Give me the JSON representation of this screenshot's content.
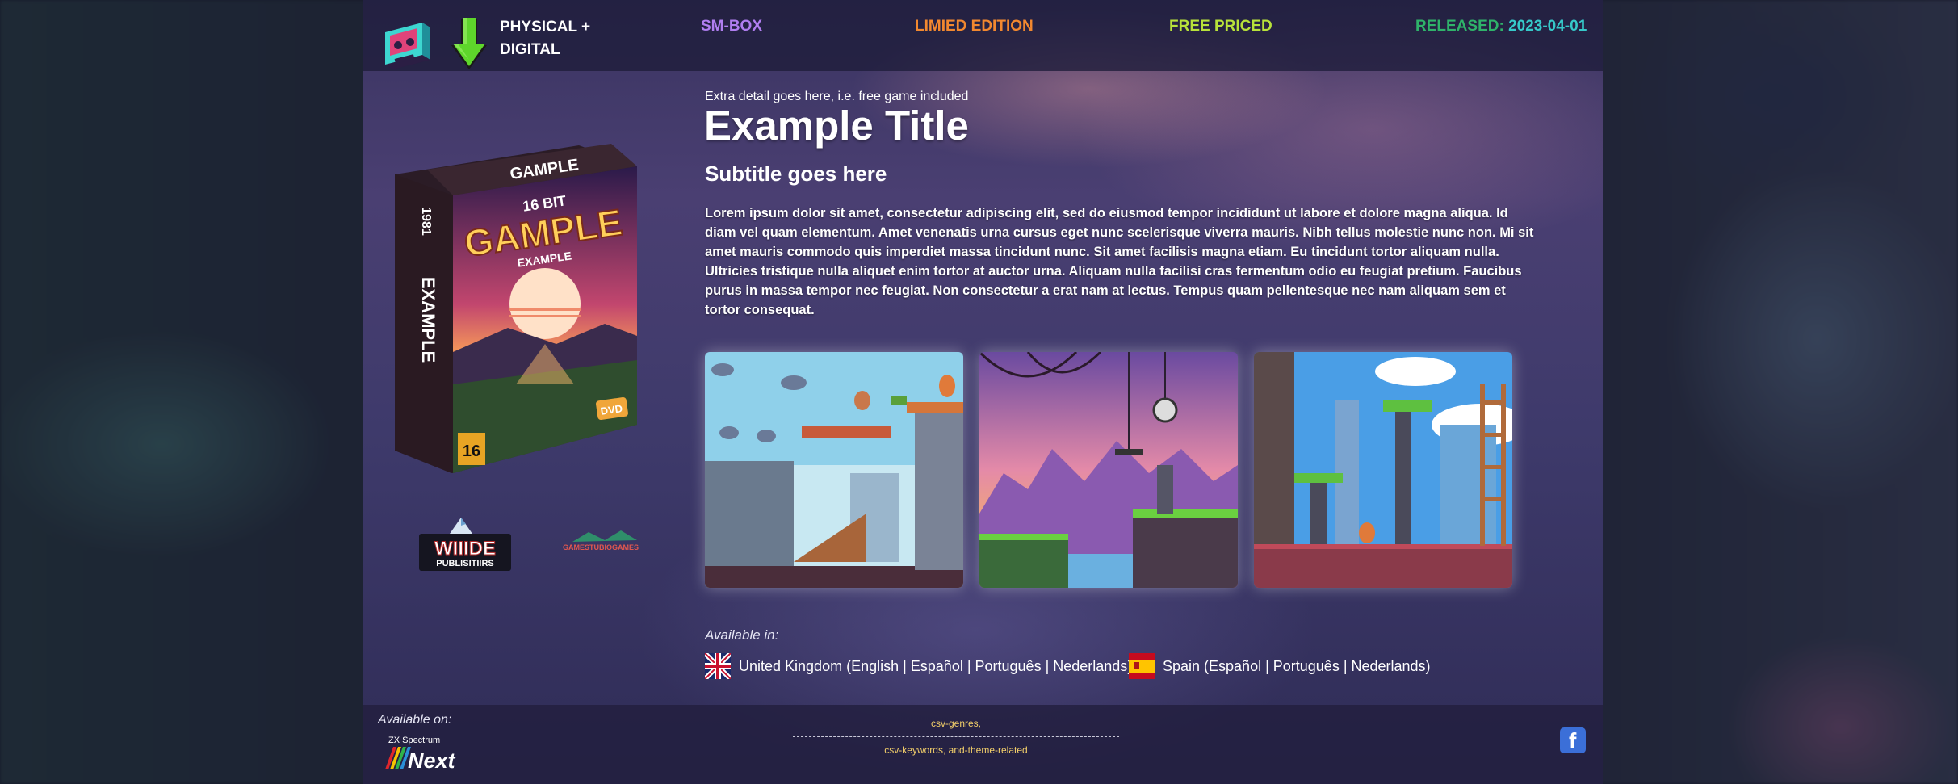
{
  "header": {
    "brand_line1": "PHYSICAL +",
    "brand_line2": "DIGITAL",
    "platform": "SM-BOX",
    "edition": "LIMIED EDITION",
    "price": "FREE PRICED",
    "released_label": "RELEASED:",
    "released_date": "2023-04-01"
  },
  "box_art": {
    "top_label": "GAMPLE",
    "subtitle_bits": "16 BIT",
    "logo": "GAMPLE",
    "tagline": "EXAMPLE",
    "spine_text": "EXAMPLE",
    "spine_year": "1981",
    "age_rating": "16",
    "media": "DVD"
  },
  "publishers": {
    "pub1_line1": "WIIIDE",
    "pub1_line2": "PUBLISITIIRS",
    "pub2": "GAMESTUBIOGAMES"
  },
  "content": {
    "extra": "Extra detail goes here, i.e. free game included",
    "title": "Example Title",
    "subtitle": "Subtitle goes here",
    "body": "Lorem ipsum dolor sit amet, consectetur adipiscing elit, sed do eiusmod tempor incididunt ut labore et dolore magna aliqua. Id diam vel quam elementum. Amet venenatis urna cursus eget nunc scelerisque viverra mauris. Nibh tellus molestie nunc non. Mi sit amet mauris commodo quis imperdiet massa tincidunt nunc. Sit amet facilisis magna etiam. Eu tincidunt tortor aliquam nulla. Ultricies tristique nulla aliquet enim tortor at auctor urna. Aliquam nulla facilisi cras fermentum odio eu feugiat pretium. Faucibus purus in massa tempor nec feugiat. Non consectetur a erat nam at lectus. Tempus quam pellentesque nec nam aliquam sem et tortor consequat."
  },
  "availability": {
    "label": "Available in:",
    "regions": [
      {
        "flag": "uk-flag-icon",
        "text": "United Kingdom (English | Español | Português | Nederlands)"
      },
      {
        "flag": "spain-flag-icon",
        "text": "Spain (Español | Português | Nederlands)"
      }
    ]
  },
  "footer": {
    "available_on": "Available on:",
    "platform_logo_top": "ZX Spectrum",
    "platform_logo_main": "Next",
    "genres": "csv-genres,",
    "keywords": "csv-keywords, and-theme-related",
    "social_icon": "facebook-icon",
    "social_letter": "f"
  },
  "colors": {
    "smbox": "#b07ef0",
    "limited": "#f2882f",
    "free": "#b8e23a",
    "released_label": "#2fb36a",
    "released_date": "#36c9c9",
    "tags": "#f4d06a"
  }
}
